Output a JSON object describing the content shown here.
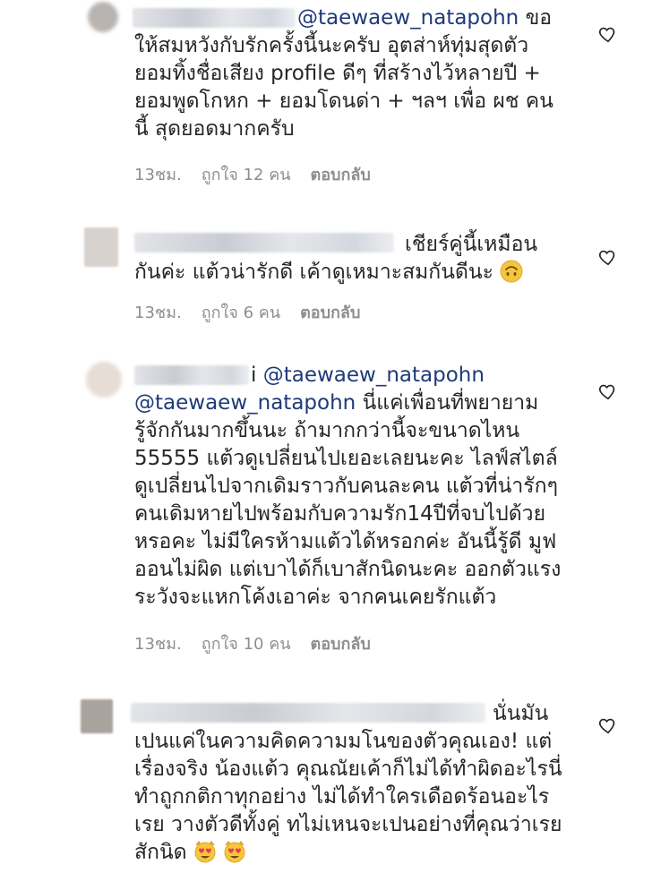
{
  "comments": [
    {
      "mention": "@taewaew_natapohn",
      "lines": [
        "ขอ",
        "ให้สมหวังกับรักครั้งนี้นะครับ อุตส่าห์ทุ่มสุดตัว",
        "ยอมทิ้งชื่อเสียง profile ดีๆ ที่สร้างไว้หลายปี +",
        "ยอมพูดโกหก + ยอมโดนด่า + ฯลฯ เพื่อ ผช คน",
        "นี้ สุดยอดมากครับ"
      ],
      "time": "13ชม.",
      "likes": "ถูกใจ 12 คน",
      "reply": "ตอบกลับ"
    },
    {
      "lines": [
        "เชียร์คู่นี้เหมือน",
        "กันค่ะ แต้วน่ารักดี เค้าดูเหมาะสมกันดีนะ"
      ],
      "emoji": "upside-down-face",
      "time": "13ชม.",
      "likes": "ถูกใจ 6 คน",
      "reply": "ตอบกลับ"
    },
    {
      "name_tail": "i",
      "mention": "@taewaew_natapohn",
      "mention2": "@taewaew_natapohn",
      "lines": [
        "นี่แค่เพื่อนที่พยายาม",
        "รู้จักกันมากขึ้นนะ ถ้ามากกว่านี้จะขนาดไหน",
        "55555 แต้วดูเปลี่ยนไปเยอะเลยนะคะ ไลฟ์สไตล์",
        "ดูเปลี่ยนไปจากเดิมราวกับคนละคน แต้วที่น่ารักๆ",
        "คนเดิมหายไปพร้อมกับความรัก14ปีที่จบไปด้วย",
        "หรอคะ ไม่มีใครห้ามแต้วได้หรอกค่ะ อันนี้รู้ดี มูฟ",
        "ออนไม่ผิด แต่เบาได้ก็เบาสักนิดนะคะ ออกตัวแรง",
        "ระวังจะแหกโค้งเอาค่ะ จากคนเคยรักแต้ว"
      ],
      "time": "13ชม.",
      "likes": "ถูกใจ 10 คน",
      "reply": "ตอบกลับ"
    },
    {
      "lines": [
        "นั่นมัน",
        "เปนแค่ในความคิดความมโนของตัวคุณเอง! แต่",
        "เรื่องจริง น้องแต้ว คุณณัยเค้าก็ไม่ได้ทำผิดอะไรนี่",
        "ทำถูกกติกาทุกอย่าง ไม่ได้ทำใครเดือดร้อนอะไร",
        "เรย วางตัวดีทั้งคู่ ทไม่เหนจะเปนอย่างที่คุณว่าเรย",
        "สักนิด"
      ],
      "emoji": "heart-eyes-cat",
      "emoji_count": 2
    }
  ],
  "colors": {
    "text": "#262626",
    "meta": "#8e8e8e",
    "mention": "#1f3a78",
    "heart_stroke": "#262626"
  }
}
